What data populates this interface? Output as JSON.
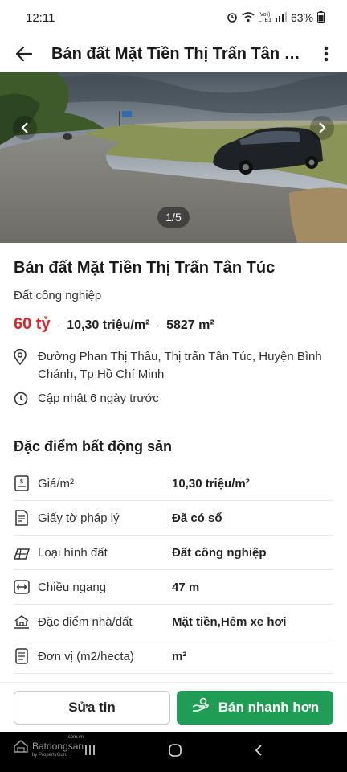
{
  "status_bar": {
    "time": "12:11",
    "network_top": "Vo))",
    "network_bottom": "LTE1",
    "battery": "63%",
    "icons": [
      "alarm-icon",
      "wifi-icon",
      "signal-icon",
      "battery-icon"
    ]
  },
  "app_bar": {
    "title": "Bán đất Mặt Tiền Thị Trấn Tân Túc",
    "back_icon": "arrow-left-icon",
    "more_icon": "more-vertical-icon"
  },
  "gallery": {
    "counter": "1/5",
    "current": 1,
    "total": 5
  },
  "listing": {
    "title": "Bán đất Mặt Tiền Thị Trấn Tân Túc",
    "category": "Đất công nghiệp",
    "price": "60 tỷ",
    "price_per_m2": "10,30 triệu/m²",
    "area": "5827 m²",
    "address": "Đường Phan Thị Thâu, Thị trấn Tân Túc, Huyện Bình Chánh, Tp Hồ Chí Minh",
    "updated": "Cập nhật 6 ngày trước"
  },
  "specs": {
    "section_title": "Đặc điểm bất động sản",
    "rows": [
      {
        "icon": "price-tag-icon",
        "label": "Giá/m²",
        "value": "10,30 triệu/m²"
      },
      {
        "icon": "legal-document-icon",
        "label": "Giấy tờ pháp lý",
        "value": "Đã có sổ"
      },
      {
        "icon": "land-type-icon",
        "label": "Loại hình đất",
        "value": "Đất công nghiệp"
      },
      {
        "icon": "width-arrows-icon",
        "label": "Chiều ngang",
        "value": "47 m"
      },
      {
        "icon": "house-features-icon",
        "label": "Đặc điểm nhà/đất",
        "value": "Mặt tiền,Hẻm xe hơi"
      },
      {
        "icon": "unit-icon",
        "label": "Đơn vị (m2/hecta)",
        "value": "m²"
      }
    ]
  },
  "actions": {
    "edit_label": "Sửa tin",
    "sell_label": "Bán nhanh hơn"
  },
  "watermark": {
    "brand": "Batdongsan",
    "suffix": ".com.vn",
    "by": "by PropertyGuru"
  },
  "colors": {
    "price_red": "#e0242a",
    "sell_green": "#1f9d55"
  }
}
